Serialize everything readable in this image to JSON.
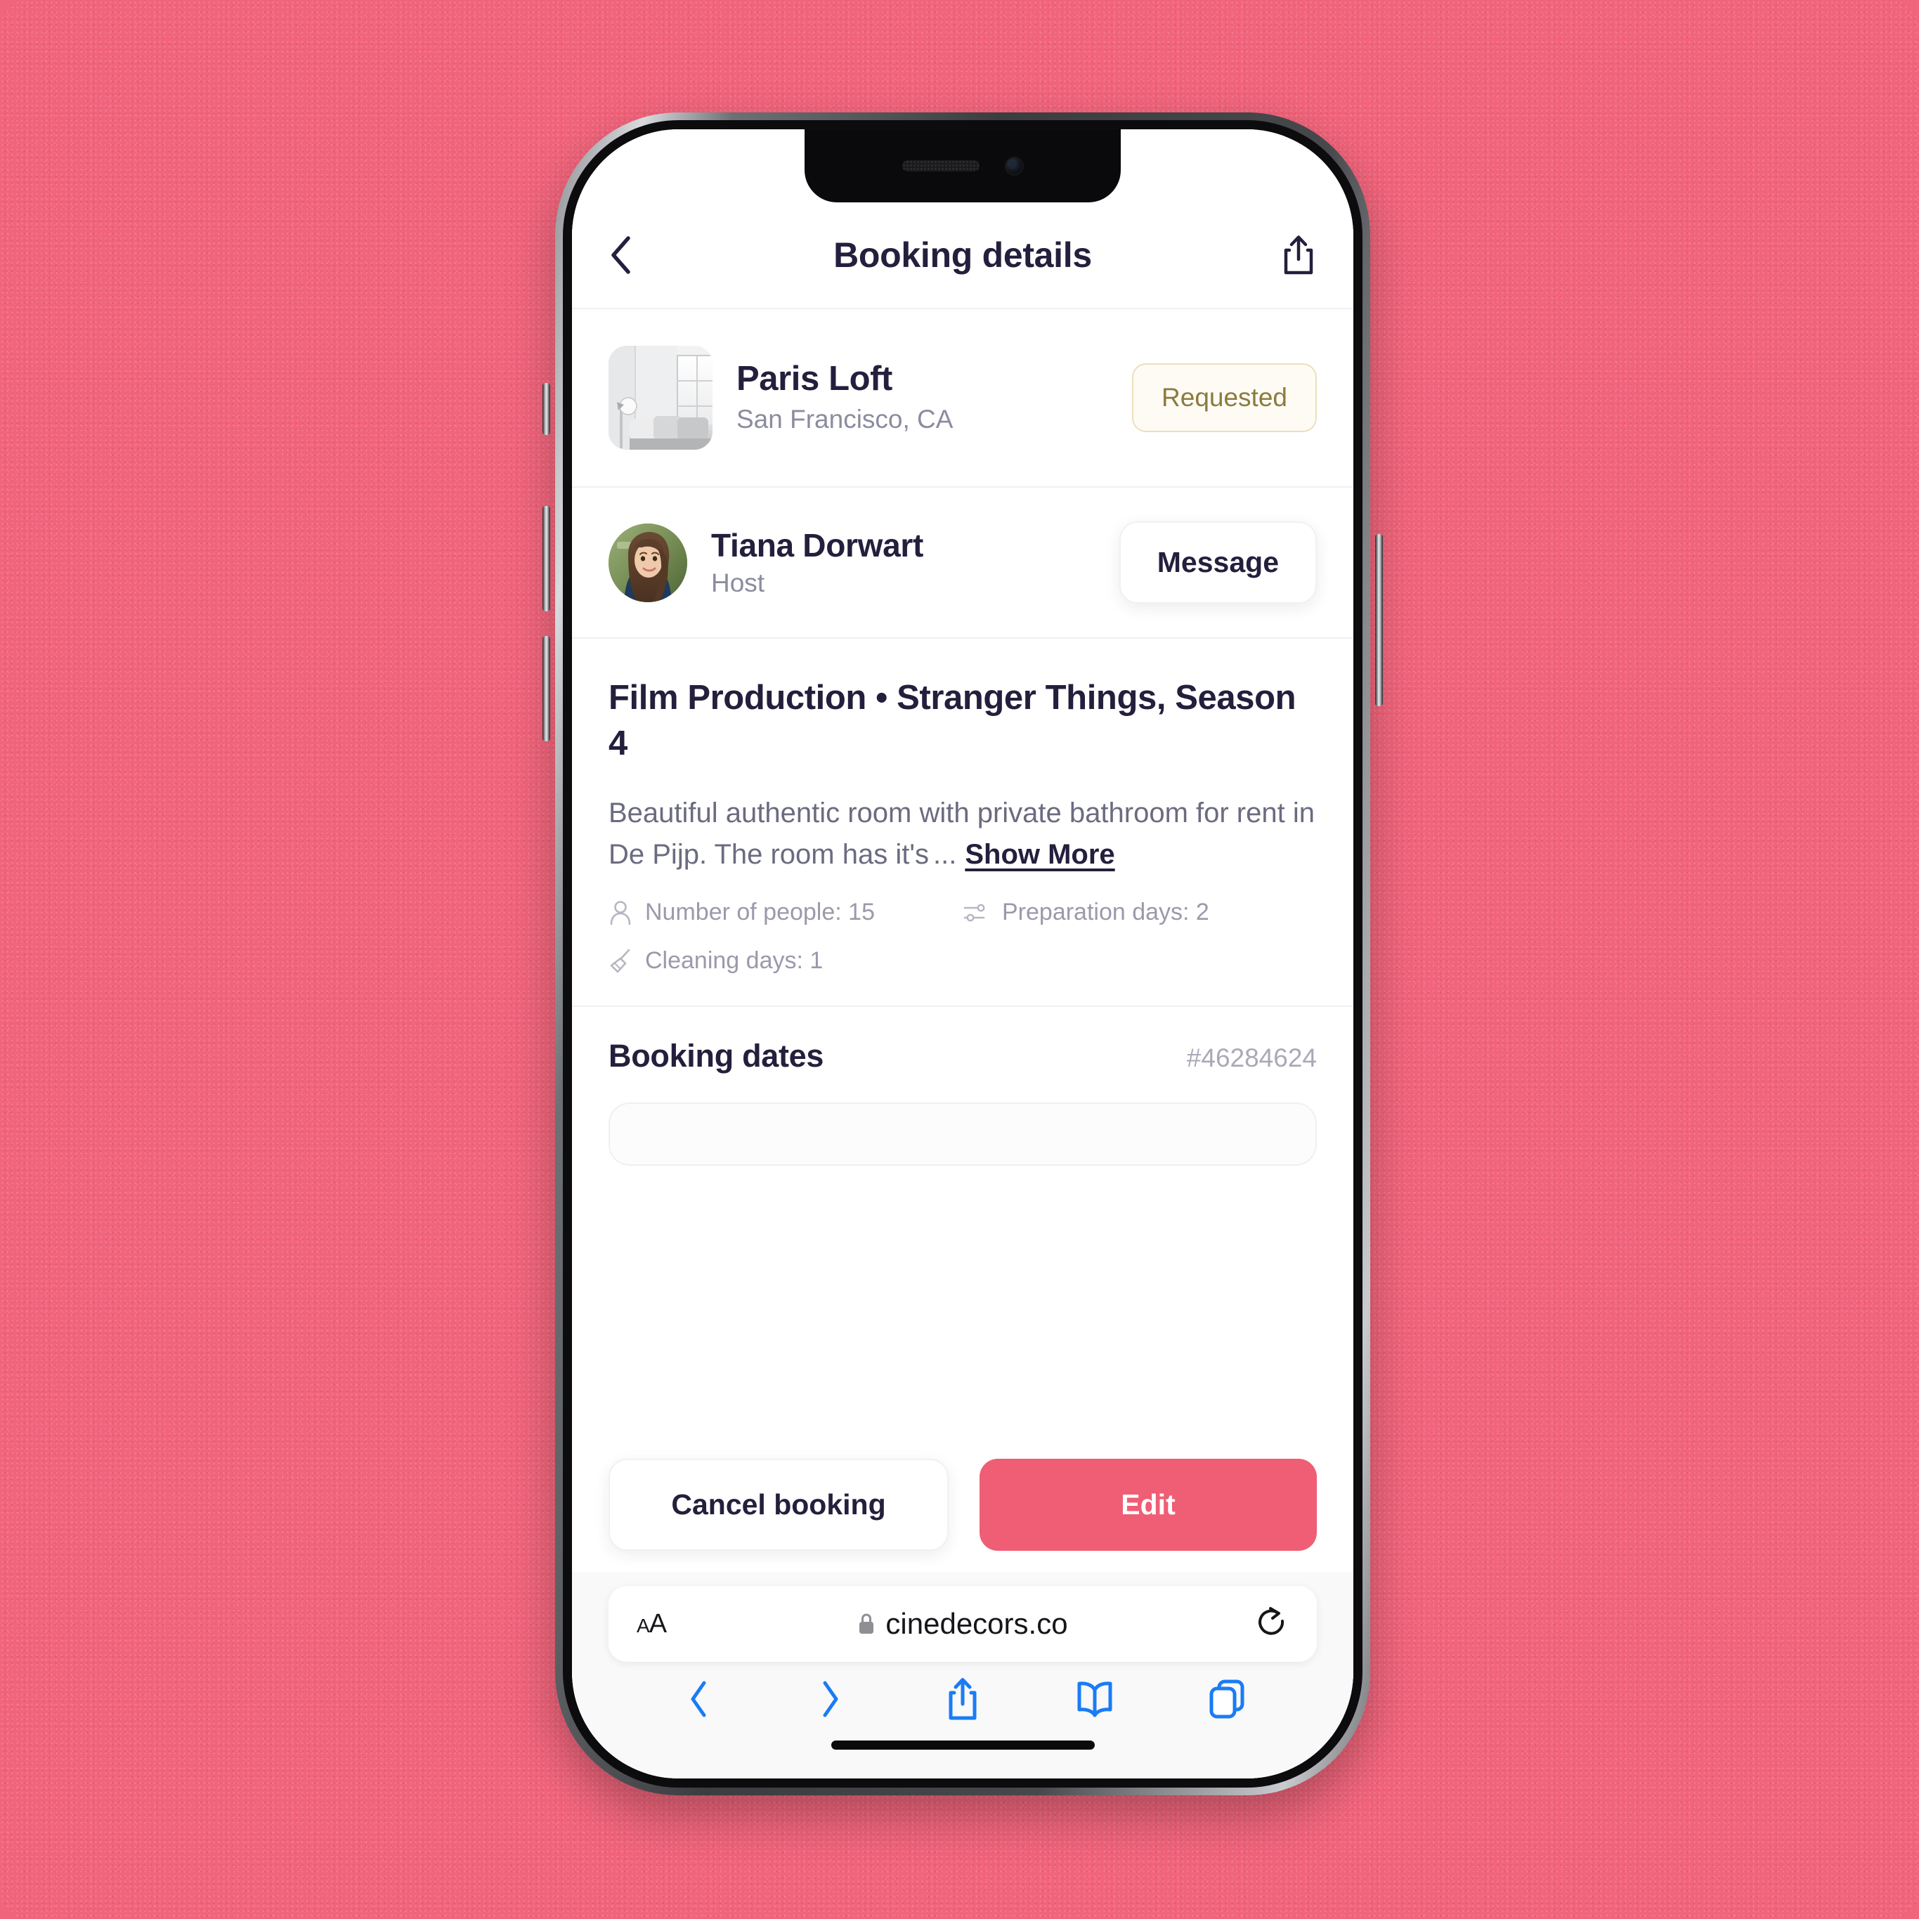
{
  "background": {
    "color": "#f2647b"
  },
  "navbar": {
    "back_icon": "chevron-left-icon",
    "title": "Booking details",
    "share_icon": "share-icon"
  },
  "property": {
    "thumbnail_alt": "Paris Loft interior photo",
    "name": "Paris Loft",
    "location": "San Francisco, CA",
    "status": "Requested",
    "status_color": "#8b7b3f",
    "status_bg": "#fdfbf4",
    "status_border": "#ecdfba"
  },
  "host": {
    "avatar_alt": "Tiana Dorwart profile photo",
    "name": "Tiana Dorwart",
    "role": "Host",
    "message_label": "Message"
  },
  "production": {
    "title": "Film Production • Stranger Things, Season 4",
    "description": "Beautiful authentic room with private bathroom for rent in De Pijp. The room has it's",
    "ellipsis": "...",
    "show_more_label": "Show More",
    "meta": [
      {
        "icon": "person-icon",
        "label": "Number of people: 15"
      },
      {
        "icon": "sliders-icon",
        "label": "Preparation days: 2"
      },
      {
        "icon": "broom-icon",
        "label": "Cleaning days: 1"
      }
    ]
  },
  "booking_dates": {
    "title": "Booking dates",
    "booking_id": "#46284624"
  },
  "actions": {
    "cancel_label": "Cancel booking",
    "edit_label": "Edit",
    "edit_color": "#ef5e74"
  },
  "safari": {
    "text_size_label": "A",
    "text_size_label_small": "A",
    "lock_icon": "lock-icon",
    "url": "cinedecors.co",
    "reload_icon": "reload-icon",
    "toolbar": [
      {
        "icon": "back-icon"
      },
      {
        "icon": "forward-icon"
      },
      {
        "icon": "share-icon"
      },
      {
        "icon": "bookmarks-icon"
      },
      {
        "icon": "tabs-icon"
      }
    ],
    "accent_color": "#1a7cf5"
  }
}
